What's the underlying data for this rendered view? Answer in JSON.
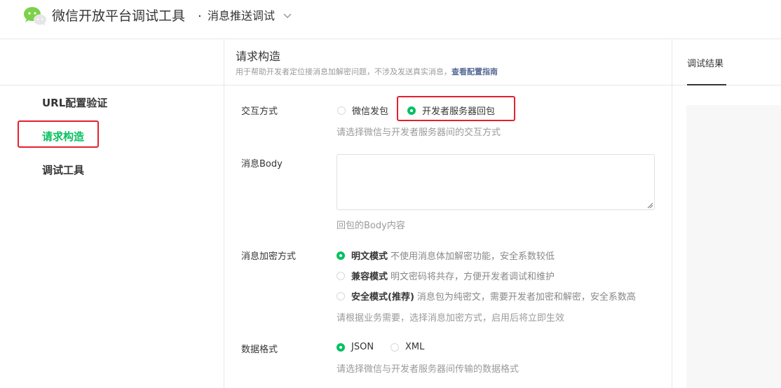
{
  "header": {
    "app_title": "微信开放平台调试工具",
    "separator": "·",
    "page_title": "消息推送调试"
  },
  "sidebar": {
    "items": [
      {
        "label": "URL配置验证",
        "active": false
      },
      {
        "label": "请求构造",
        "active": true
      },
      {
        "label": "调试工具",
        "active": false
      }
    ]
  },
  "main": {
    "title": "请求构造",
    "description": "用于帮助开发者定位接消息加解密问题，不涉及发送真实消息，",
    "guide_link": "查看配置指南",
    "interaction": {
      "label": "交互方式",
      "options": [
        {
          "label": "微信发包",
          "selected": false
        },
        {
          "label": "开发者服务器回包",
          "selected": true
        }
      ],
      "hint": "请选择微信与开发者服务器间的交互方式"
    },
    "body": {
      "label": "消息Body",
      "value": "",
      "hint": "回包的Body内容"
    },
    "encryption": {
      "label": "消息加密方式",
      "options": [
        {
          "label": "明文模式",
          "desc": "不使用消息体加解密功能，安全系数较低",
          "selected": true
        },
        {
          "label": "兼容模式",
          "desc": "明文密码将共存，方便开发者调试和维护",
          "selected": false
        },
        {
          "label": "安全模式(推荐)",
          "desc": "消息包为纯密文，需要开发者加密和解密，安全系数高",
          "selected": false
        }
      ],
      "hint": "请根据业务需要，选择消息加密方式，启用后将立即生效"
    },
    "format": {
      "label": "数据格式",
      "options": [
        {
          "label": "JSON",
          "selected": true
        },
        {
          "label": "XML",
          "selected": false
        }
      ],
      "hint": "请选择微信与开发者服务器间传输的数据格式"
    }
  },
  "result": {
    "tab_label": "调试结果"
  },
  "colors": {
    "accent": "#07c160",
    "link": "#576b95",
    "highlight_box": "#e5202e"
  },
  "icons": {
    "logo": "wechat-logo-icon",
    "chevron": "chevron-down-icon"
  }
}
